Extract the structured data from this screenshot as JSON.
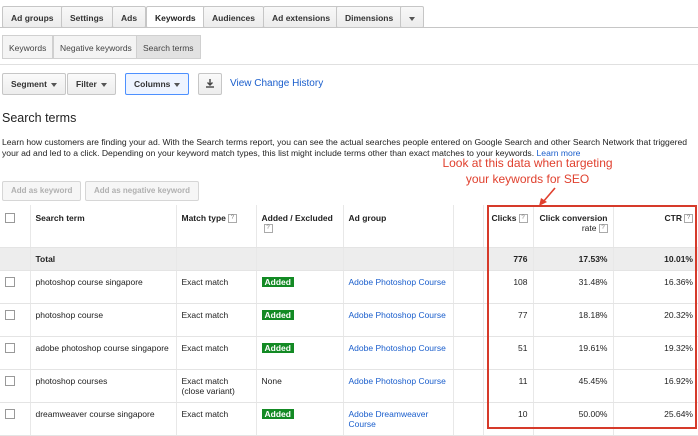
{
  "tabs": [
    "Ad groups",
    "Settings",
    "Ads",
    "Keywords",
    "Audiences",
    "Ad extensions",
    "Dimensions"
  ],
  "subtabs": [
    "Keywords",
    "Negative keywords",
    "Search terms"
  ],
  "toolbar": {
    "segment": "Segment",
    "filter": "Filter",
    "columns": "Columns",
    "download_icon": "download-icon",
    "view_change_history": "View Change History"
  },
  "page": {
    "title": "Search terms",
    "description": "Learn how customers are finding your ad. With the Search terms report, you can see the actual searches people entered on Google Search and other Search Network that triggered your ad and led to a click. Depending on your keyword match types, this list might include terms other than exact matches to your keywords.",
    "learn_more": "Learn more"
  },
  "actions": {
    "add_keyword": "Add as keyword",
    "add_negative": "Add as negative keyword"
  },
  "annotation": {
    "line1": "Look at this data when targeting",
    "line2": "your keywords for SEO",
    "color": "#d63a2a"
  },
  "table": {
    "headers": {
      "search_term": "Search term",
      "match_type": "Match type",
      "added_excluded": "Added / Excluded",
      "ad_group": "Ad group",
      "clicks": "Clicks",
      "conv_rate_1": "Click conversion",
      "conv_rate_2": "rate",
      "ctr": "CTR",
      "help": "?"
    },
    "total": {
      "label": "Total",
      "clicks": "776",
      "conv_rate": "17.53%",
      "ctr": "10.01%"
    },
    "rows": [
      {
        "term": "photoshop course singapore",
        "match": "Exact match",
        "match2": "",
        "status": "Added",
        "group": "Adobe Photoshop Course",
        "clicks": "108",
        "conv": "31.48%",
        "ctr": "16.36%"
      },
      {
        "term": "photoshop course",
        "match": "Exact match",
        "match2": "",
        "status": "Added",
        "group": "Adobe Photoshop Course",
        "clicks": "77",
        "conv": "18.18%",
        "ctr": "20.32%"
      },
      {
        "term": "adobe photoshop course singapore",
        "match": "Exact match",
        "match2": "",
        "status": "Added",
        "group": "Adobe Photoshop Course",
        "clicks": "51",
        "conv": "19.61%",
        "ctr": "19.32%"
      },
      {
        "term": "photoshop courses",
        "match": "Exact match",
        "match2": "(close variant)",
        "status": "None",
        "group": "Adobe Photoshop Course",
        "clicks": "11",
        "conv": "45.45%",
        "ctr": "16.92%"
      },
      {
        "term": "dreamweaver course singapore",
        "match": "Exact match",
        "match2": "",
        "status": "Added",
        "group": "Adobe Dreamweaver Course",
        "clicks": "10",
        "conv": "50.00%",
        "ctr": "25.64%"
      }
    ]
  }
}
